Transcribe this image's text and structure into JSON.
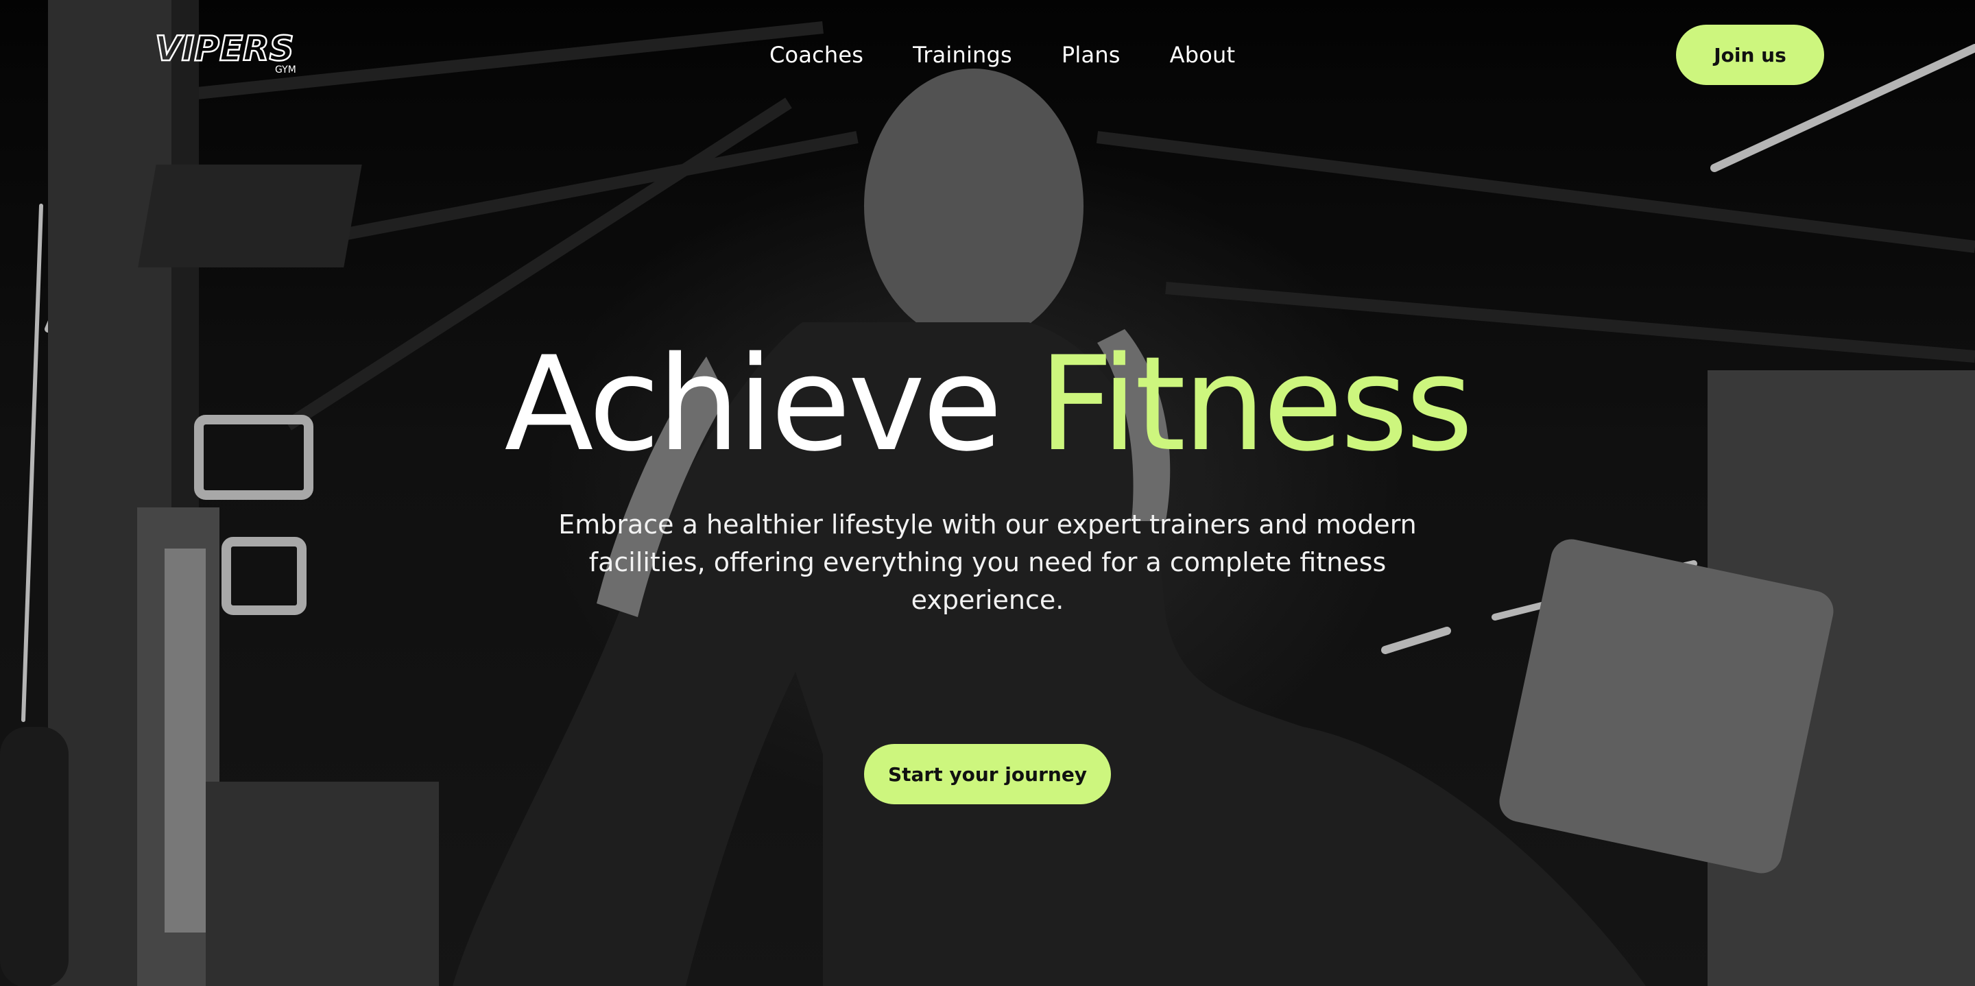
{
  "brand": {
    "logo_text": "VIPERS",
    "logo_subtext": "GYM",
    "accent_color": "#cdf67e"
  },
  "nav": {
    "items": [
      {
        "label": "Coaches"
      },
      {
        "label": "Trainings"
      },
      {
        "label": "Plans"
      },
      {
        "label": "About"
      }
    ],
    "join_label": "Join us"
  },
  "hero": {
    "headline_part1": "Achieve",
    "headline_part2": "Fitness",
    "subtitle": "Embrace a healthier lifestyle with our expert trainers and modern facilities, offering everything you need for a complete fitness experience.",
    "cta_label": "Start your journey",
    "background_image": "grayscale photo of a woman training on a gym machine"
  }
}
